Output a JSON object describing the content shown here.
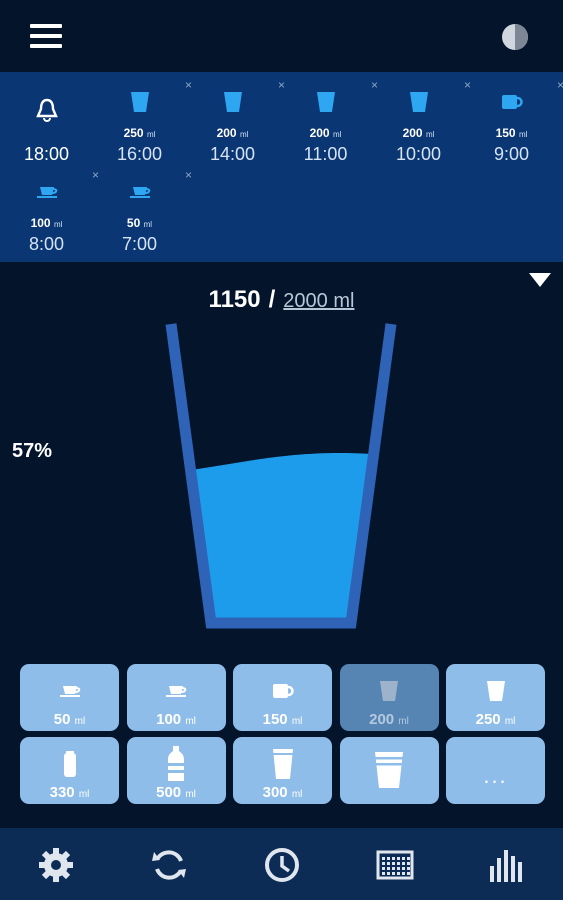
{
  "header": {
    "menu_icon": "hamburger-menu-icon",
    "theme_icon": "half-circle-theme-icon"
  },
  "history": {
    "delete_glyph": "×",
    "entries": [
      {
        "type": "alarm",
        "icon": "bell-icon",
        "time": "18:00"
      },
      {
        "type": "drink",
        "icon": "glass-icon",
        "amount": "250",
        "unit": "ml",
        "time": "16:00"
      },
      {
        "type": "drink",
        "icon": "glass-icon",
        "amount": "200",
        "unit": "ml",
        "time": "14:00"
      },
      {
        "type": "drink",
        "icon": "glass-icon",
        "amount": "200",
        "unit": "ml",
        "time": "11:00"
      },
      {
        "type": "drink",
        "icon": "glass-icon",
        "amount": "200",
        "unit": "ml",
        "time": "10:00"
      },
      {
        "type": "drink",
        "icon": "mug-icon",
        "amount": "150",
        "unit": "ml",
        "time": "9:00"
      },
      {
        "type": "drink",
        "icon": "coffee-cup-icon",
        "amount": "100",
        "unit": "ml",
        "time": "8:00"
      },
      {
        "type": "drink",
        "icon": "coffee-cup-icon",
        "amount": "50",
        "unit": "ml",
        "time": "7:00"
      }
    ]
  },
  "progress": {
    "current": "1150",
    "separator": "/",
    "goal": "2000 ml",
    "percent": "57%",
    "fill_fraction": 0.57
  },
  "cups": [
    {
      "icon": "coffee-cup-icon",
      "amount": "50",
      "unit": "ml"
    },
    {
      "icon": "coffee-cup-icon",
      "amount": "100",
      "unit": "ml"
    },
    {
      "icon": "mug-icon",
      "amount": "150",
      "unit": "ml"
    },
    {
      "icon": "glass-icon",
      "amount": "200",
      "unit": "ml",
      "dim": true
    },
    {
      "icon": "glass-icon",
      "amount": "250",
      "unit": "ml"
    },
    {
      "icon": "can-icon",
      "amount": "330",
      "unit": "ml"
    },
    {
      "icon": "bottle-icon",
      "amount": "500",
      "unit": "ml"
    },
    {
      "icon": "tall-glass-icon",
      "amount": "300",
      "unit": "ml"
    },
    {
      "icon": "large-glass-icon",
      "amount": "",
      "unit": ""
    },
    {
      "icon": "more-icon",
      "more": "..."
    }
  ],
  "nav": {
    "icons": [
      "gear-icon",
      "refresh-icon",
      "clock-icon",
      "calendar-icon",
      "bar-chart-icon"
    ]
  },
  "colors": {
    "background": "#04152b",
    "history_panel": "#0a3673",
    "water": "#1e9cec",
    "glass_border": "#2e63b8",
    "cup_button": "#8fbde9",
    "cup_button_dim": "#5685b3",
    "nav_bar": "#0c2b55"
  }
}
